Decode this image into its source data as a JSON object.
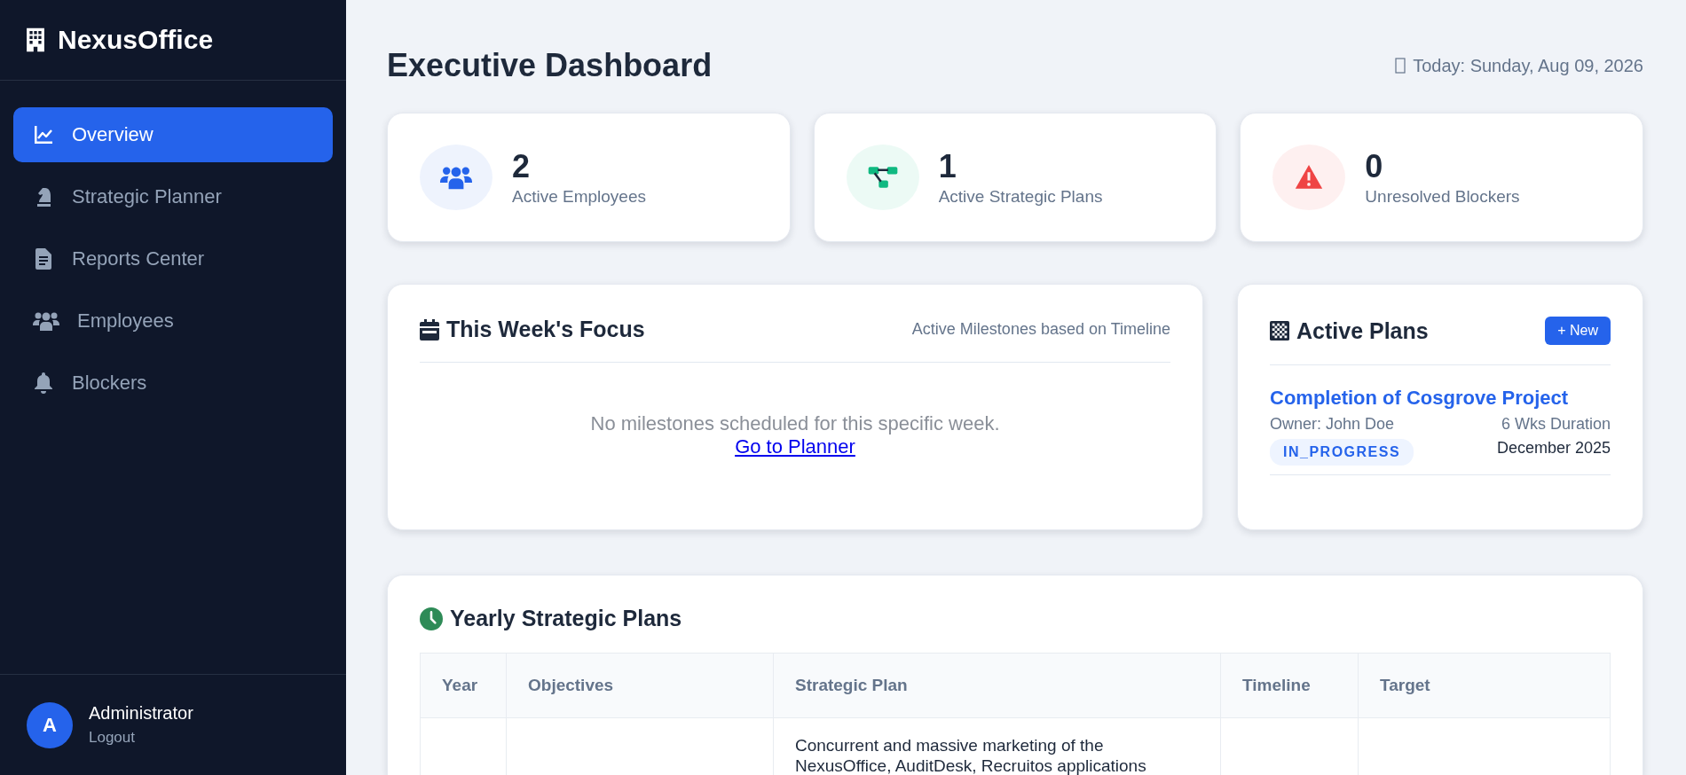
{
  "sidebar": {
    "brand": "NexusOffice",
    "items": [
      {
        "label": "Overview",
        "selected": true
      },
      {
        "label": "Strategic Planner",
        "selected": false
      },
      {
        "label": "Reports Center",
        "selected": false
      },
      {
        "label": "Employees",
        "selected": false
      },
      {
        "label": "Blockers",
        "selected": false
      }
    ],
    "user": {
      "avatar": "A",
      "name": "Administrator",
      "logout": "Logout"
    }
  },
  "header": {
    "title": "Executive Dashboard",
    "date": "Today: Sunday, Aug 09, 2026"
  },
  "stats": [
    {
      "value": "2",
      "label": "Active Employees",
      "color": "#2563eb"
    },
    {
      "value": "1",
      "label": "Active Strategic Plans",
      "color": "#10b981"
    },
    {
      "value": "0",
      "label": "Unresolved Blockers",
      "color": "#ef4444"
    }
  ],
  "focus": {
    "title": "This Week's Focus",
    "subtitle": "Active Milestones based on Timeline",
    "empty": "No milestones scheduled for this specific week.",
    "link": "Go to Planner"
  },
  "active_plans": {
    "title": "Active Plans",
    "new_button": "+ New",
    "plans": [
      {
        "name": "Completion of Cosgrove Project",
        "owner": "Owner: John Doe",
        "duration": "6 Wks Duration",
        "status": "IN_PROGRESS",
        "date": "December 2025"
      }
    ]
  },
  "yearly": {
    "title": "Yearly Strategic Plans",
    "columns": [
      "Year",
      "Objectives",
      "Strategic Plan",
      "Timeline",
      "Target"
    ],
    "rows": [
      [
        "",
        "",
        "Concurrent and massive marketing of the NexusOffice, AuditDesk, Recruitos applications",
        "",
        ""
      ]
    ]
  }
}
